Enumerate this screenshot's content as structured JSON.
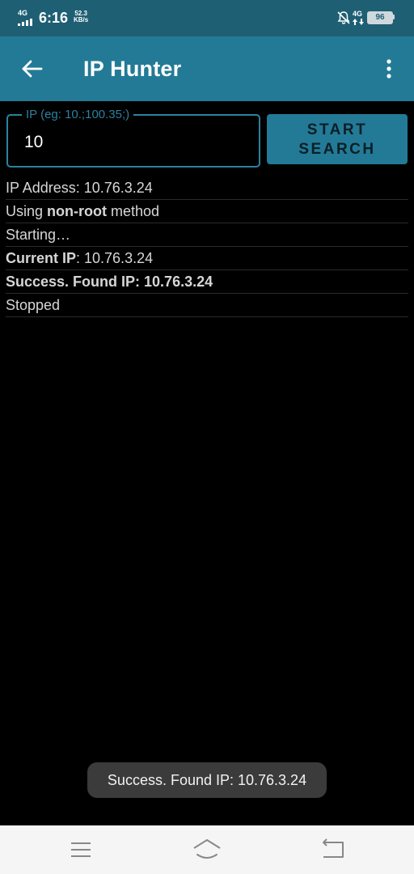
{
  "status_bar": {
    "network_left": "4G",
    "time": "6:16",
    "speed_value": "52.3",
    "speed_unit": "KB/s",
    "network_right": "4G",
    "battery": "96",
    "icons": [
      "signal-bars-icon",
      "bell-off-icon",
      "data-arrows-icon",
      "battery-icon"
    ]
  },
  "app_bar": {
    "title": "IP Hunter",
    "icons": [
      "back-arrow-icon",
      "overflow-menu-icon"
    ]
  },
  "form": {
    "ip_label": "IP (eg: 10.;100.35;)",
    "ip_value": "10",
    "start_line1": "START",
    "start_line2": "SEARCH"
  },
  "log": {
    "row1": "IP Address: 10.76.3.24",
    "row2_prefix": "Using ",
    "row2_bold": "non-root",
    "row2_suffix": " method",
    "row3": "Starting…",
    "row4_bold": "Current IP",
    "row4_rest": ": 10.76.3.24",
    "row5_bold": "Success. Found IP: 10.76.3.24",
    "row6": "Stopped"
  },
  "toast": {
    "text": "Success. Found IP: 10.76.3.24"
  },
  "nav_bar": {
    "icons": [
      "menu-icon",
      "home-icon",
      "back-icon"
    ]
  },
  "colors": {
    "status_bar": "#1e5f74",
    "app_bar": "#237a96",
    "accent": "#2b82a0",
    "background": "#000000"
  }
}
